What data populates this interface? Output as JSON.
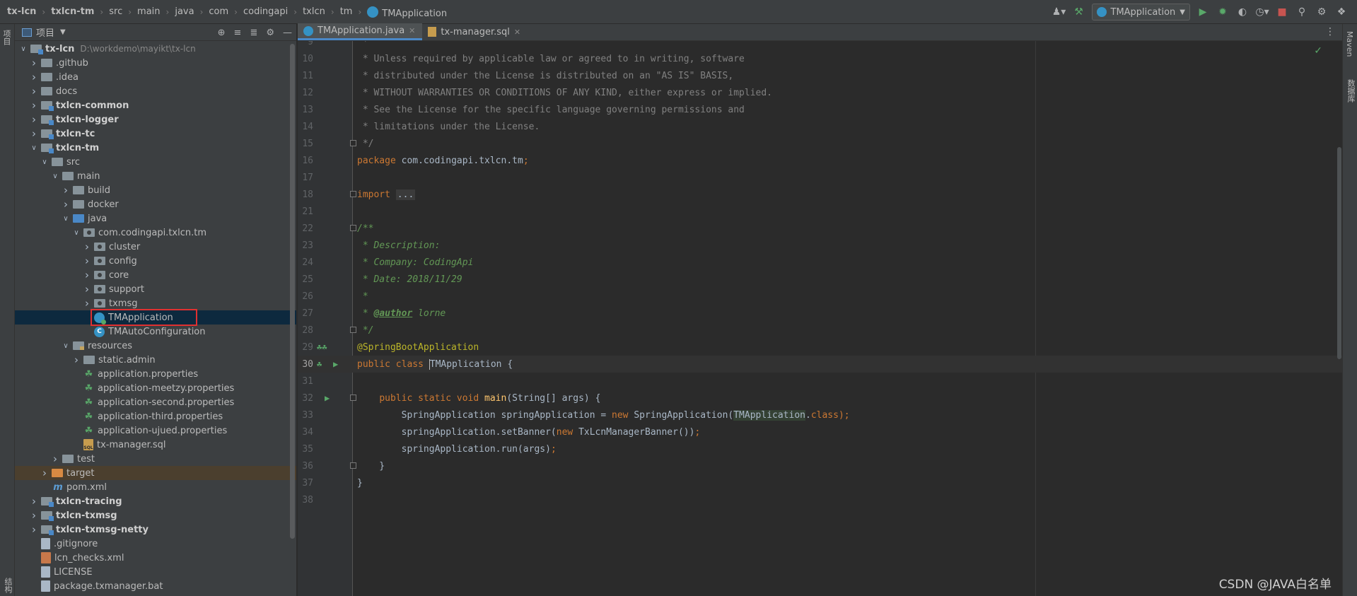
{
  "breadcrumb": [
    {
      "label": "tx-lcn",
      "bold": true
    },
    {
      "label": "txlcn-tm",
      "bold": true
    },
    {
      "label": "src",
      "bold": false
    },
    {
      "label": "main",
      "bold": false
    },
    {
      "label": "java",
      "bold": false
    },
    {
      "label": "com",
      "bold": false
    },
    {
      "label": "codingapi",
      "bold": false
    },
    {
      "label": "txlcn",
      "bold": false
    },
    {
      "label": "tm",
      "bold": false
    },
    {
      "label": "TMApplication",
      "bold": false,
      "icon": "spring-boot-class-icon"
    }
  ],
  "toolbar": {
    "run_config": "TMApplication"
  },
  "left_strip": {
    "project_label": "项目",
    "bottom_label": "结构"
  },
  "project_panel": {
    "title": "项目",
    "tree": [
      {
        "label": "tx-lcn",
        "path": "D:\\workdemo\\mayikt\\tx-lcn",
        "indent": 0,
        "arrow": "down",
        "icon": "module",
        "bold": true
      },
      {
        "label": ".github",
        "indent": 1,
        "arrow": "right",
        "icon": "folder"
      },
      {
        "label": ".idea",
        "indent": 1,
        "arrow": "right",
        "icon": "folder"
      },
      {
        "label": "docs",
        "indent": 1,
        "arrow": "right",
        "icon": "folder"
      },
      {
        "label": "txlcn-common",
        "indent": 1,
        "arrow": "right",
        "icon": "module",
        "bold": true
      },
      {
        "label": "txlcn-logger",
        "indent": 1,
        "arrow": "right",
        "icon": "module",
        "bold": true
      },
      {
        "label": "txlcn-tc",
        "indent": 1,
        "arrow": "right",
        "icon": "module",
        "bold": true
      },
      {
        "label": "txlcn-tm",
        "indent": 1,
        "arrow": "down",
        "icon": "module",
        "bold": true
      },
      {
        "label": "src",
        "indent": 2,
        "arrow": "down",
        "icon": "folder"
      },
      {
        "label": "main",
        "indent": 3,
        "arrow": "down",
        "icon": "folder"
      },
      {
        "label": "build",
        "indent": 4,
        "arrow": "right",
        "icon": "folder"
      },
      {
        "label": "docker",
        "indent": 4,
        "arrow": "right",
        "icon": "folder"
      },
      {
        "label": "java",
        "indent": 4,
        "arrow": "down",
        "icon": "src"
      },
      {
        "label": "com.codingapi.txlcn.tm",
        "indent": 5,
        "arrow": "down",
        "icon": "pkg"
      },
      {
        "label": "cluster",
        "indent": 6,
        "arrow": "right",
        "icon": "pkg"
      },
      {
        "label": "config",
        "indent": 6,
        "arrow": "right",
        "icon": "pkg"
      },
      {
        "label": "core",
        "indent": 6,
        "arrow": "right",
        "icon": "pkg"
      },
      {
        "label": "support",
        "indent": 6,
        "arrow": "right",
        "icon": "pkg"
      },
      {
        "label": "txmsg",
        "indent": 6,
        "arrow": "right",
        "icon": "pkg"
      },
      {
        "label": "TMApplication",
        "indent": 6,
        "arrow": "none",
        "icon": "boot",
        "selected": true,
        "boxed": true
      },
      {
        "label": "TMAutoConfiguration",
        "indent": 6,
        "arrow": "none",
        "icon": "class"
      },
      {
        "label": "resources",
        "indent": 4,
        "arrow": "down",
        "icon": "res"
      },
      {
        "label": "static.admin",
        "indent": 5,
        "arrow": "right",
        "icon": "folder"
      },
      {
        "label": "application.properties",
        "indent": 5,
        "arrow": "none",
        "icon": "props"
      },
      {
        "label": "application-meetzy.properties",
        "indent": 5,
        "arrow": "none",
        "icon": "props"
      },
      {
        "label": "application-second.properties",
        "indent": 5,
        "arrow": "none",
        "icon": "props"
      },
      {
        "label": "application-third.properties",
        "indent": 5,
        "arrow": "none",
        "icon": "props"
      },
      {
        "label": "application-ujued.properties",
        "indent": 5,
        "arrow": "none",
        "icon": "props"
      },
      {
        "label": "tx-manager.sql",
        "indent": 5,
        "arrow": "none",
        "icon": "sql"
      },
      {
        "label": "test",
        "indent": 3,
        "arrow": "right",
        "icon": "folder"
      },
      {
        "label": "target",
        "indent": 2,
        "arrow": "right",
        "icon": "target",
        "excluded": true
      },
      {
        "label": "pom.xml",
        "indent": 2,
        "arrow": "none",
        "icon": "maven"
      },
      {
        "label": "txlcn-tracing",
        "indent": 1,
        "arrow": "right",
        "icon": "module",
        "bold": true
      },
      {
        "label": "txlcn-txmsg",
        "indent": 1,
        "arrow": "right",
        "icon": "module",
        "bold": true
      },
      {
        "label": "txlcn-txmsg-netty",
        "indent": 1,
        "arrow": "right",
        "icon": "module",
        "bold": true
      },
      {
        "label": ".gitignore",
        "indent": 1,
        "arrow": "none",
        "icon": "txt"
      },
      {
        "label": "lcn_checks.xml",
        "indent": 1,
        "arrow": "none",
        "icon": "xml"
      },
      {
        "label": "LICENSE",
        "indent": 1,
        "arrow": "none",
        "icon": "txt"
      },
      {
        "label": "package.txmanager.bat",
        "indent": 1,
        "arrow": "none",
        "icon": "txt"
      }
    ]
  },
  "editor": {
    "tabs": [
      {
        "label": "TMApplication.java",
        "active": true,
        "icon": "class"
      },
      {
        "label": "tx-manager.sql",
        "active": false,
        "icon": "sql"
      }
    ],
    "lines": [
      {
        "n": "9",
        "tokens": [
          {
            "t": " *",
            "c": "cmt"
          }
        ]
      },
      {
        "n": "10",
        "tokens": [
          {
            "t": " * Unless required by applicable law or agreed to in writing, software",
            "c": "cmt"
          }
        ]
      },
      {
        "n": "11",
        "tokens": [
          {
            "t": " * distributed under the License is distributed on an \"AS IS\" BASIS,",
            "c": "cmt"
          }
        ]
      },
      {
        "n": "12",
        "tokens": [
          {
            "t": " * WITHOUT WARRANTIES OR CONDITIONS OF ANY KIND, either express or implied.",
            "c": "cmt"
          }
        ]
      },
      {
        "n": "13",
        "tokens": [
          {
            "t": " * See the License for the specific language governing permissions and",
            "c": "cmt"
          }
        ]
      },
      {
        "n": "14",
        "tokens": [
          {
            "t": " * limitations under the License.",
            "c": "cmt"
          }
        ]
      },
      {
        "n": "15",
        "tokens": [
          {
            "t": " */",
            "c": "cmt"
          }
        ],
        "fold": true
      },
      {
        "n": "16",
        "tokens": [
          {
            "t": "package ",
            "c": "kw"
          },
          {
            "t": "com.codingapi.txlcn.tm",
            "c": ""
          },
          {
            "t": ";",
            "c": "kw"
          }
        ]
      },
      {
        "n": "17",
        "tokens": []
      },
      {
        "n": "18",
        "tokens": [
          {
            "t": "import ",
            "c": "kw"
          },
          {
            "t": "...",
            "c": "fold-text"
          }
        ],
        "fold": true
      },
      {
        "n": "21",
        "tokens": []
      },
      {
        "n": "22",
        "tokens": [
          {
            "t": "/**",
            "c": "doc"
          }
        ],
        "fold": true
      },
      {
        "n": "23",
        "tokens": [
          {
            "t": " * Description:",
            "c": "doc"
          }
        ]
      },
      {
        "n": "24",
        "tokens": [
          {
            "t": " * Company: CodingApi",
            "c": "doc"
          }
        ]
      },
      {
        "n": "25",
        "tokens": [
          {
            "t": " * Date: 2018/11/29",
            "c": "doc"
          }
        ]
      },
      {
        "n": "26",
        "tokens": [
          {
            "t": " *",
            "c": "doc"
          }
        ]
      },
      {
        "n": "27",
        "tokens": [
          {
            "t": " * ",
            "c": "doc"
          },
          {
            "t": "@author",
            "c": "doc-tag"
          },
          {
            "t": " lorne",
            "c": "doc"
          }
        ]
      },
      {
        "n": "28",
        "tokens": [
          {
            "t": " */",
            "c": "doc"
          }
        ],
        "fold": true
      },
      {
        "n": "29",
        "tokens": [
          {
            "t": "@SpringBootApplication",
            "c": "ann"
          }
        ],
        "gutter": "bean"
      },
      {
        "n": "30",
        "tokens": [
          {
            "t": "public class ",
            "c": "kw"
          },
          {
            "t": "TMApplication",
            "c": "caret-word"
          },
          {
            "t": " {",
            "c": ""
          }
        ],
        "gutter": "run-bean",
        "current": true
      },
      {
        "n": "31",
        "tokens": []
      },
      {
        "n": "32",
        "tokens": [
          {
            "t": "    ",
            "c": ""
          },
          {
            "t": "public static void ",
            "c": "kw"
          },
          {
            "t": "main",
            "c": "fn"
          },
          {
            "t": "(String[] args) {",
            "c": ""
          }
        ],
        "gutter": "run",
        "fold": true
      },
      {
        "n": "33",
        "tokens": [
          {
            "t": "        SpringApplication springApplication = ",
            "c": ""
          },
          {
            "t": "new ",
            "c": "kw"
          },
          {
            "t": "SpringApplication(",
            "c": ""
          },
          {
            "t": "TMApplication",
            "c": "hl-class"
          },
          {
            "t": ".",
            "c": ""
          },
          {
            "t": "class",
            "c": "kw"
          },
          {
            "t": ");",
            "c": "kw"
          }
        ]
      },
      {
        "n": "34",
        "tokens": [
          {
            "t": "        springApplication.setBanner(",
            "c": ""
          },
          {
            "t": "new ",
            "c": "kw"
          },
          {
            "t": "TxLcnManagerBanner())",
            "c": ""
          },
          {
            "t": ";",
            "c": "kw"
          }
        ]
      },
      {
        "n": "35",
        "tokens": [
          {
            "t": "        springApplication.run(args)",
            "c": ""
          },
          {
            "t": ";",
            "c": "kw"
          }
        ]
      },
      {
        "n": "36",
        "tokens": [
          {
            "t": "    }",
            "c": ""
          }
        ],
        "fold": true
      },
      {
        "n": "37",
        "tokens": [
          {
            "t": "}",
            "c": ""
          }
        ]
      },
      {
        "n": "38",
        "tokens": []
      }
    ]
  },
  "right_strip": {
    "maven_label": "Maven",
    "db_label": "数据库"
  },
  "watermark": "CSDN @JAVA白名单"
}
